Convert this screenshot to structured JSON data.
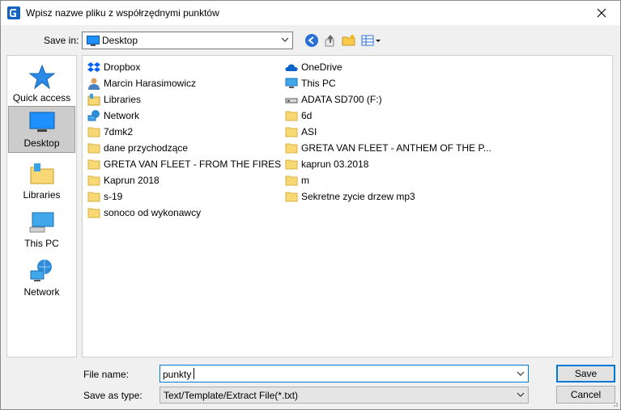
{
  "window": {
    "title": "Wpisz nazwe pliku z współrzędnymi punktów"
  },
  "toolbar": {
    "save_in_label": "Save in:",
    "location": "Desktop"
  },
  "places": [
    {
      "label": "Quick access",
      "icon": "quick-access-star-icon"
    },
    {
      "label": "Desktop",
      "icon": "desktop-icon",
      "selected": true
    },
    {
      "label": "Libraries",
      "icon": "libraries-icon"
    },
    {
      "label": "This PC",
      "icon": "this-pc-icon"
    },
    {
      "label": "Network",
      "icon": "network-icon"
    }
  ],
  "files_left": [
    {
      "name": "Dropbox",
      "icon": "dropbox-icon"
    },
    {
      "name": "Marcin Harasimowicz",
      "icon": "user-folder-icon"
    },
    {
      "name": "Libraries",
      "icon": "libraries-icon"
    },
    {
      "name": "Network",
      "icon": "network-icon"
    },
    {
      "name": "7dmk2",
      "icon": "folder-icon"
    },
    {
      "name": "dane przychodzące",
      "icon": "folder-icon"
    },
    {
      "name": "GRETA VAN FLEET - FROM THE FIRES",
      "icon": "folder-icon"
    },
    {
      "name": "Kaprun 2018",
      "icon": "folder-icon"
    },
    {
      "name": "s-19",
      "icon": "folder-icon"
    },
    {
      "name": "sonoco od wykonawcy",
      "icon": "folder-icon"
    }
  ],
  "files_right": [
    {
      "name": "OneDrive",
      "icon": "onedrive-icon"
    },
    {
      "name": "This PC",
      "icon": "this-pc-icon"
    },
    {
      "name": "ADATA SD700 (F:)",
      "icon": "drive-icon"
    },
    {
      "name": "6d",
      "icon": "folder-icon"
    },
    {
      "name": "ASI",
      "icon": "folder-icon"
    },
    {
      "name": "GRETA VAN FLEET - ANTHEM OF THE P...",
      "icon": "folder-icon"
    },
    {
      "name": "kaprun 03.2018",
      "icon": "folder-icon"
    },
    {
      "name": "m",
      "icon": "folder-icon"
    },
    {
      "name": "Sekretne zycie drzew mp3",
      "icon": "folder-icon"
    }
  ],
  "bottom": {
    "file_name_label": "File name:",
    "file_name_value": "punkty",
    "save_as_type_label": "Save as type:",
    "save_as_type_value": "Text/Template/Extract File(*.txt)",
    "save_button": "Save",
    "cancel_button": "Cancel"
  },
  "colors": {
    "accent": "#0078d7",
    "folder": "#f8d775",
    "selected": "#cccccc"
  }
}
